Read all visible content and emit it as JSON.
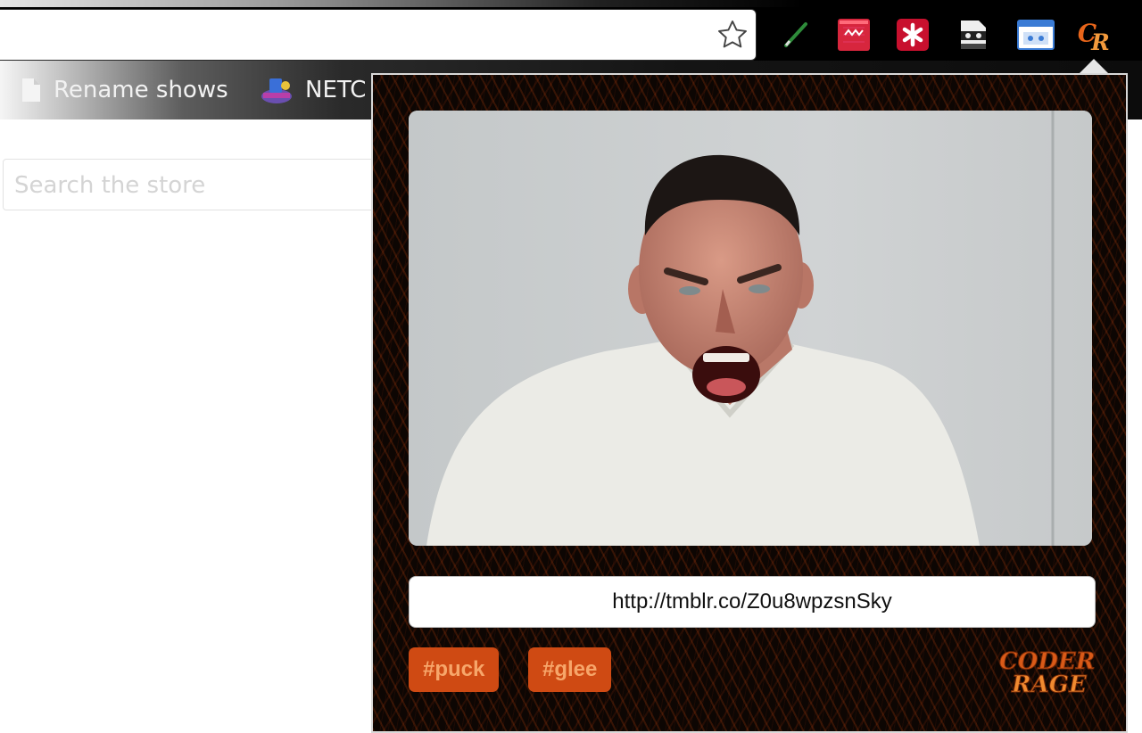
{
  "browser": {
    "address_bar": {
      "value": "",
      "placeholder": ""
    },
    "bookmark_star_icon": "star-icon",
    "extensions": [
      {
        "name": "pen-extension-icon"
      },
      {
        "name": "zipper-extension-icon",
        "color": "#d7263d"
      },
      {
        "name": "lastpass-extension-icon",
        "color": "#c8102e"
      },
      {
        "name": "masked-thief-extension-icon"
      },
      {
        "name": "window-screenshot-extension-icon",
        "color": "#3a7bd5"
      },
      {
        "name": "coder-rage-extension-icon",
        "color": "#e8651a"
      }
    ]
  },
  "bookmarks": [
    {
      "label": "Rename shows",
      "icon": "page-icon"
    },
    {
      "label": "NETC",
      "icon": "netflix-cloud-icon"
    }
  ],
  "store": {
    "search_placeholder": "Search the store"
  },
  "popup": {
    "gif_alt": "man in white t-shirt screaming",
    "short_url": "http://tmblr.co/Z0u8wpzsnSky",
    "tags": [
      "#puck",
      "#glee"
    ],
    "logo_text": [
      "CODER",
      "RAGE"
    ],
    "accent_color": "#cf4a13"
  }
}
